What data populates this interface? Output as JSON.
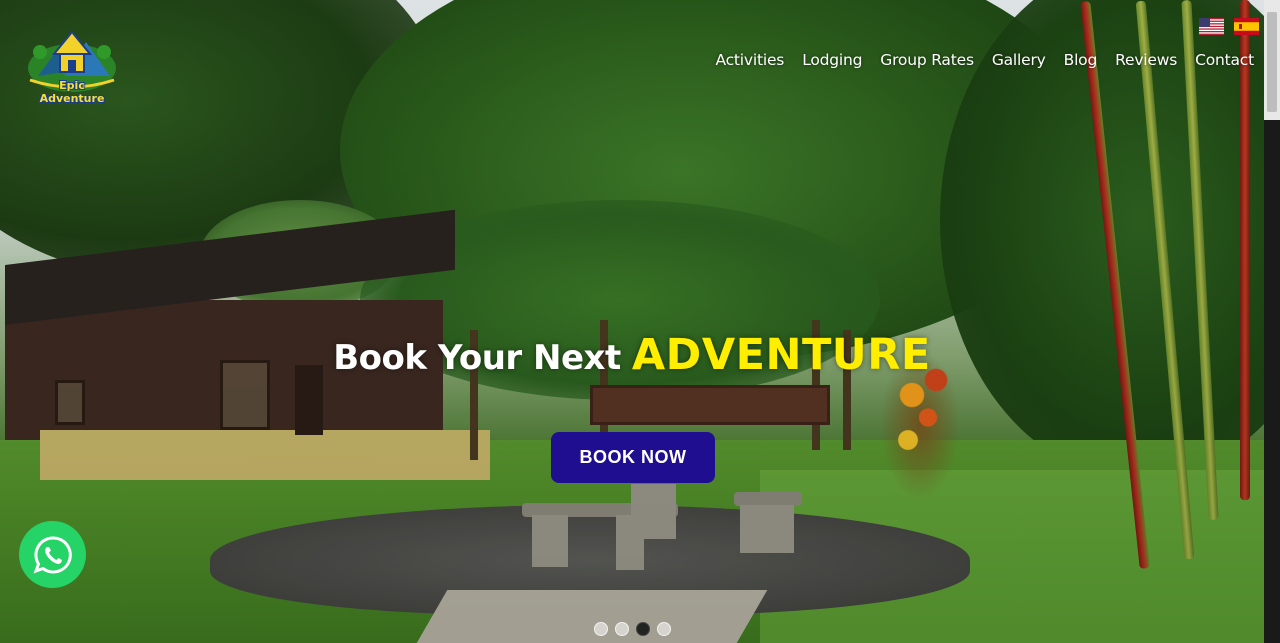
{
  "brand": {
    "logo_text": "Epic Adventure",
    "logo_icon": "mountain-lodge-logo"
  },
  "languages": [
    {
      "name": "English",
      "icon": "us-flag-icon"
    },
    {
      "name": "Español",
      "icon": "spain-flag-icon"
    }
  ],
  "nav": {
    "items": [
      {
        "label": "Activities"
      },
      {
        "label": "Lodging"
      },
      {
        "label": "Group Rates"
      },
      {
        "label": "Gallery"
      },
      {
        "label": "Blog"
      },
      {
        "label": "Reviews"
      },
      {
        "label": "Contact"
      }
    ]
  },
  "hero": {
    "headline_plain": "Book Your Next",
    "headline_accent": "ADVENTURE",
    "cta_label": "BOOK NOW",
    "background": "garden-cabin-photo"
  },
  "whatsapp": {
    "icon": "whatsapp-icon"
  },
  "slider": {
    "count": 4,
    "active_index": 2
  },
  "colors": {
    "accent_yellow": "#ffee00",
    "button_blue": "#1f0e8f",
    "whatsapp_green": "#25d366"
  }
}
